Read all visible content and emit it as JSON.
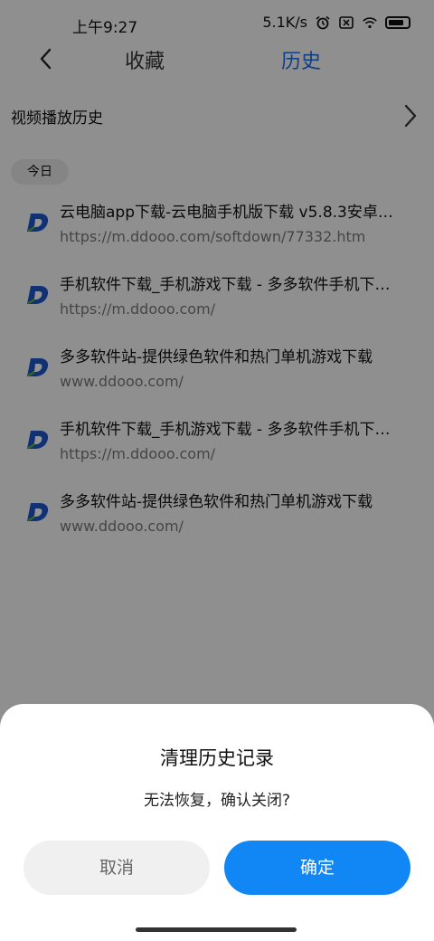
{
  "status": {
    "time": "上午9:27",
    "net_speed": "5.1K/s"
  },
  "nav": {
    "tab_favorites": "收藏",
    "tab_history": "历史"
  },
  "history_link": "视频播放历史",
  "date_group": "今日",
  "items": [
    {
      "title": "云电脑app下载-云电脑手机版下载 v5.8.3安卓…",
      "url": "https://m.ddooo.com/softdown/77332.htm"
    },
    {
      "title": "手机软件下载_手机游戏下载 - 多多软件手机下…",
      "url": "https://m.ddooo.com/"
    },
    {
      "title": "多多软件站-提供绿色软件和热门单机游戏下载",
      "url": "www.ddooo.com/"
    },
    {
      "title": "手机软件下载_手机游戏下载 - 多多软件手机下…",
      "url": "https://m.ddooo.com/"
    },
    {
      "title": "多多软件站-提供绿色软件和热门单机游戏下载",
      "url": "www.ddooo.com/"
    }
  ],
  "dialog": {
    "title": "清理历史记录",
    "message": "无法恢复，确认关闭?",
    "cancel": "取消",
    "confirm": "确定"
  },
  "colors": {
    "accent": "#1087f4",
    "active_tab": "#1b6ee6",
    "site_icon_blue": "#1d57c8",
    "site_icon_green": "#5fb82c"
  }
}
